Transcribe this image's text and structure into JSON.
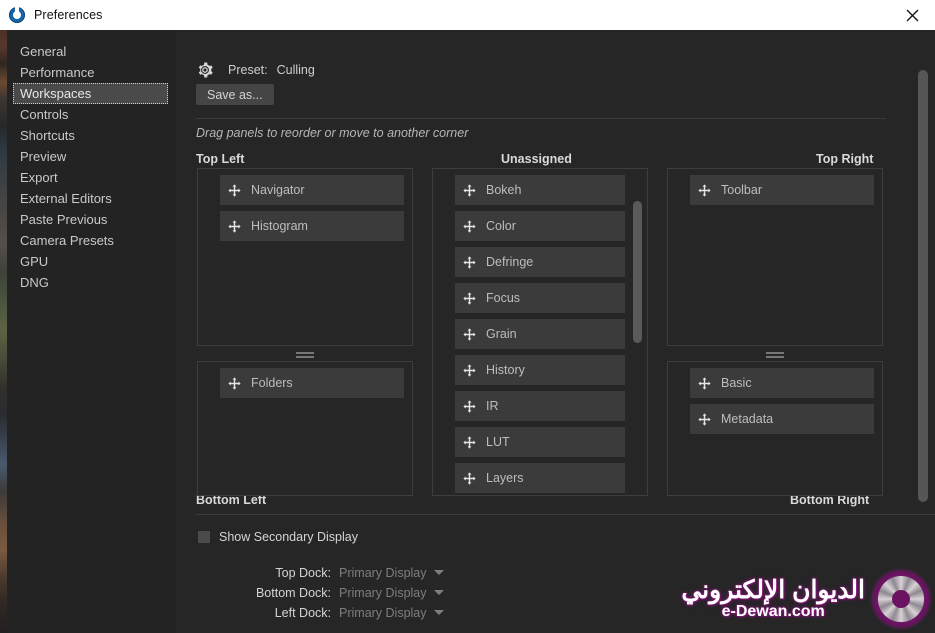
{
  "window": {
    "title": "Preferences",
    "icon": "app-logo-icon",
    "close_label": "×"
  },
  "sidebar": {
    "items": [
      {
        "label": "General",
        "selected": false
      },
      {
        "label": "Performance",
        "selected": false
      },
      {
        "label": "Workspaces",
        "selected": true
      },
      {
        "label": "Controls",
        "selected": false
      },
      {
        "label": "Shortcuts",
        "selected": false
      },
      {
        "label": "Preview",
        "selected": false
      },
      {
        "label": "Export",
        "selected": false
      },
      {
        "label": "External Editors",
        "selected": false
      },
      {
        "label": "Paste Previous",
        "selected": false
      },
      {
        "label": "Camera Presets",
        "selected": false
      },
      {
        "label": "GPU",
        "selected": false
      },
      {
        "label": "DNG",
        "selected": false
      }
    ]
  },
  "preset": {
    "icon": "gear-icon",
    "label": "Preset:",
    "value": "Culling",
    "save_as_label": "Save as..."
  },
  "hint": "Drag panels to reorder or move to another corner",
  "headings": {
    "top_left": "Top Left",
    "unassigned": "Unassigned",
    "top_right": "Top Right",
    "bottom_left": "Bottom Left",
    "bottom_right": "Bottom Right"
  },
  "groups": {
    "top_left": [
      {
        "label": "Navigator"
      },
      {
        "label": "Histogram"
      }
    ],
    "bottom_left": [
      {
        "label": "Folders"
      }
    ],
    "unassigned": [
      {
        "label": "Bokeh"
      },
      {
        "label": "Color"
      },
      {
        "label": "Defringe"
      },
      {
        "label": "Focus"
      },
      {
        "label": "Grain"
      },
      {
        "label": "History"
      },
      {
        "label": "IR"
      },
      {
        "label": "LUT"
      },
      {
        "label": "Layers"
      }
    ],
    "top_right": [
      {
        "label": "Toolbar"
      }
    ],
    "bottom_right": [
      {
        "label": "Basic"
      },
      {
        "label": "Metadata"
      }
    ]
  },
  "secondary_display": {
    "checkbox_label": "Show Secondary Display",
    "checked": false,
    "docks": [
      {
        "label": "Top Dock:",
        "value": "Primary Display"
      },
      {
        "label": "Bottom Dock:",
        "value": "Primary Display"
      },
      {
        "label": "Left Dock:",
        "value": "Primary Display"
      }
    ]
  },
  "watermark": {
    "arabic": "الديوان الإلكتروني",
    "english": "e-Dewan.com"
  },
  "colors": {
    "titlebar_bg": "#ffffff",
    "dialog_bg": "#262626",
    "sidebar_bg": "#232323",
    "panel_item_bg": "#3b3b3b",
    "selection_bg": "#4a4a4a",
    "watermark_accent": "#8d1a82"
  }
}
